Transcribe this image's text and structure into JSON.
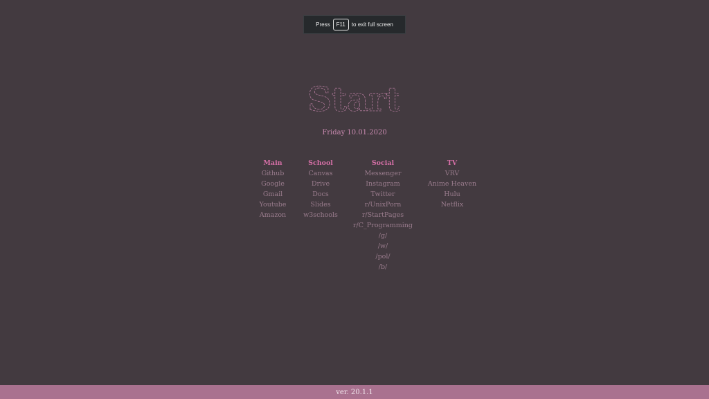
{
  "toast": {
    "press": "Press",
    "key": "F11",
    "rest": "to exit full screen"
  },
  "logo": {
    "text": "Start"
  },
  "date": "Friday 10.01.2020",
  "columns": {
    "main": {
      "heading": "Main",
      "links": [
        "Github",
        "Google",
        "Gmail",
        "Youtube",
        "Amazon"
      ]
    },
    "school": {
      "heading": "School",
      "links": [
        "Canvas",
        "Drive",
        "Docs",
        "Slides",
        "w3schools"
      ]
    },
    "social": {
      "heading": "Social",
      "links": [
        "Messenger",
        "Instagram",
        "Twitter",
        "r/UnixPorn",
        "r/StartPages",
        "r/C_Programming",
        "/g/",
        "/w/",
        "/pol/",
        "/b/"
      ]
    },
    "tv": {
      "heading": "TV",
      "links": [
        "VRV",
        "Anime Heaven",
        "Hulu",
        "Netflix"
      ]
    }
  },
  "footer": {
    "version": "ver. 20.1.1"
  },
  "colors": {
    "background": "#433a40",
    "heading": "#d56fa6",
    "link": "#9a7c8d",
    "footer_bar": "#a9718f"
  }
}
